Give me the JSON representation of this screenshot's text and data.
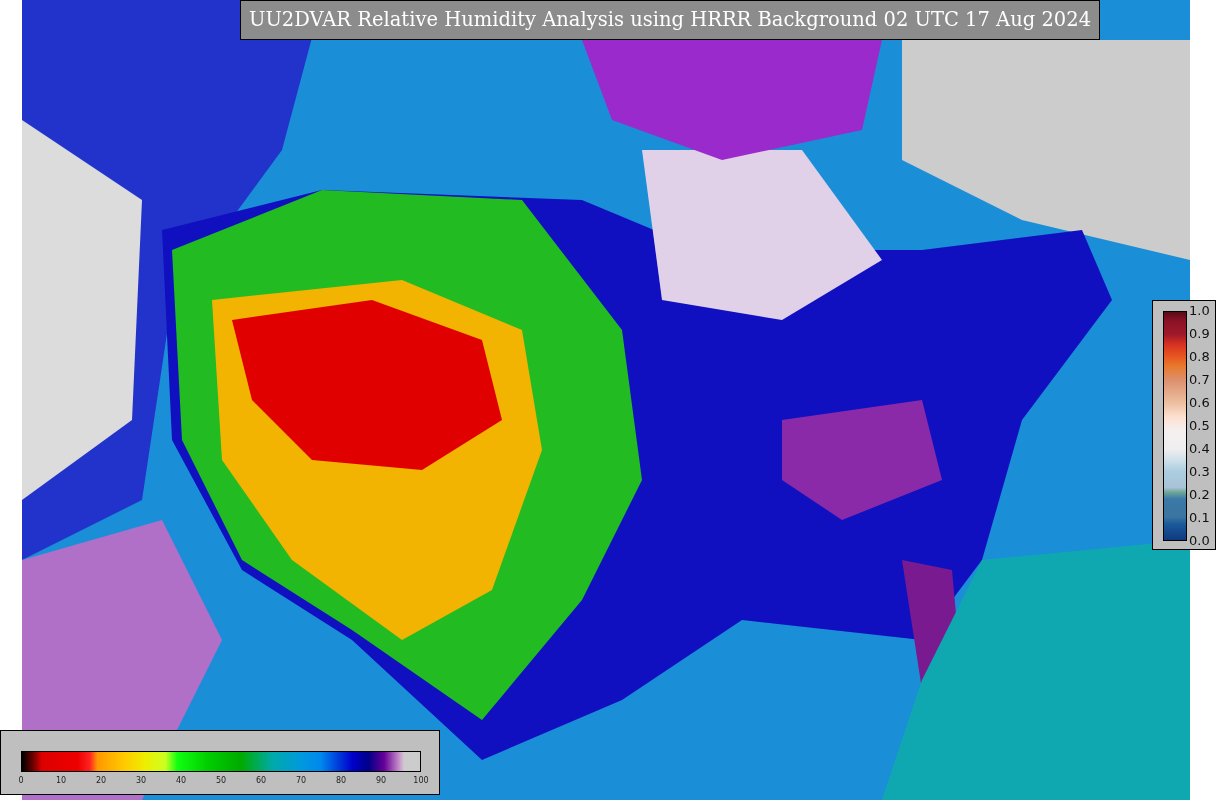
{
  "title": "UU2DVAR Relative Humidity Analysis using HRRR Background 02 UTC 17 Aug 2024",
  "side_colorbar": {
    "ticks": [
      "1.0",
      "0.9",
      "0.8",
      "0.7",
      "0.6",
      "0.5",
      "0.4",
      "0.3",
      "0.2",
      "0.1",
      "0.0"
    ]
  },
  "bottom_colorbar": {
    "ticks": [
      "0",
      "10",
      "20",
      "30",
      "40",
      "50",
      "60",
      "70",
      "80",
      "90",
      "100"
    ]
  }
}
